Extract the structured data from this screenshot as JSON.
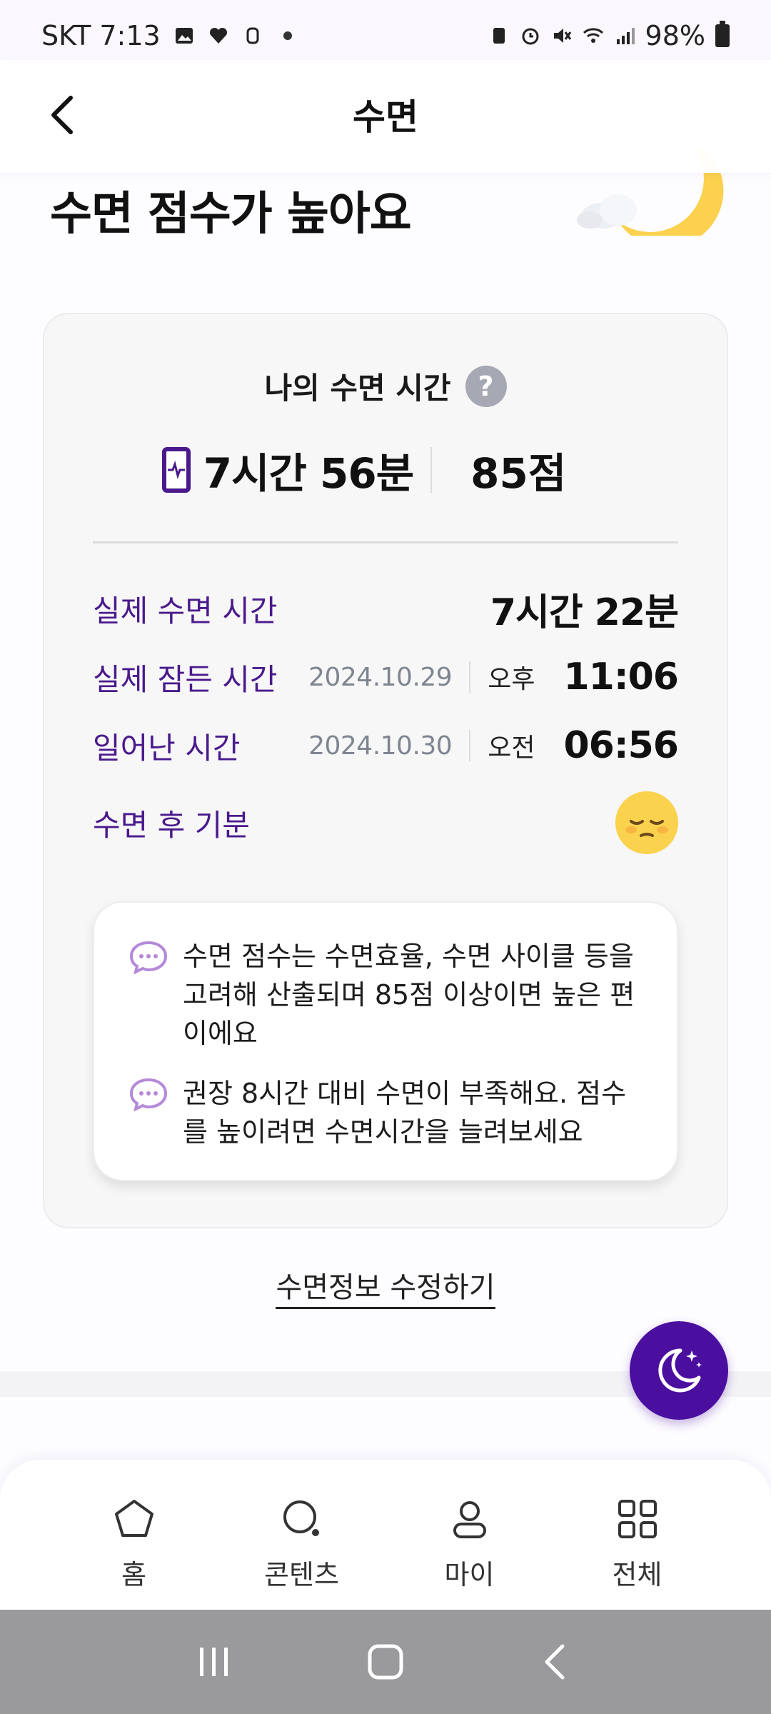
{
  "status_bar": {
    "carrier_time": "SKT 7:13",
    "battery": "98%"
  },
  "header": {
    "title": "수면"
  },
  "hero": {
    "title": "수면 점수가 높아요"
  },
  "card": {
    "label": "나의 수면 시간",
    "help_icon": "?",
    "total_time": "7시간 56분",
    "score": "85점",
    "rows": [
      {
        "label": "실제 수면 시간",
        "value": "7시간 22분"
      },
      {
        "label": "실제 잠든 시간",
        "date": "2024.10.29",
        "ampm": "오후",
        "time": "11:06"
      },
      {
        "label": "일어난 시간",
        "date": "2024.10.30",
        "ampm": "오전",
        "time": "06:56"
      },
      {
        "label": "수면 후 기분"
      }
    ],
    "tips": [
      "수면 점수는 수면효율, 수면 사이클 등을 고려해 산출되며 85점 이상이면 높은 편이에요",
      "권장 8시간 대비 수면이 부족해요. 점수를 높이려면 수면시간을 늘려보세요"
    ]
  },
  "edit_link": "수면정보 수정하기",
  "bottom_nav": [
    {
      "label": "홈",
      "icon": "pentagon-home-icon"
    },
    {
      "label": "콘텐츠",
      "icon": "search-content-icon"
    },
    {
      "label": "마이",
      "icon": "person-icon"
    },
    {
      "label": "전체",
      "icon": "grid-icon"
    }
  ],
  "colors": {
    "accent": "#4b0fa0",
    "label_purple": "#4a1a8c",
    "mood": "#fbd24e"
  }
}
